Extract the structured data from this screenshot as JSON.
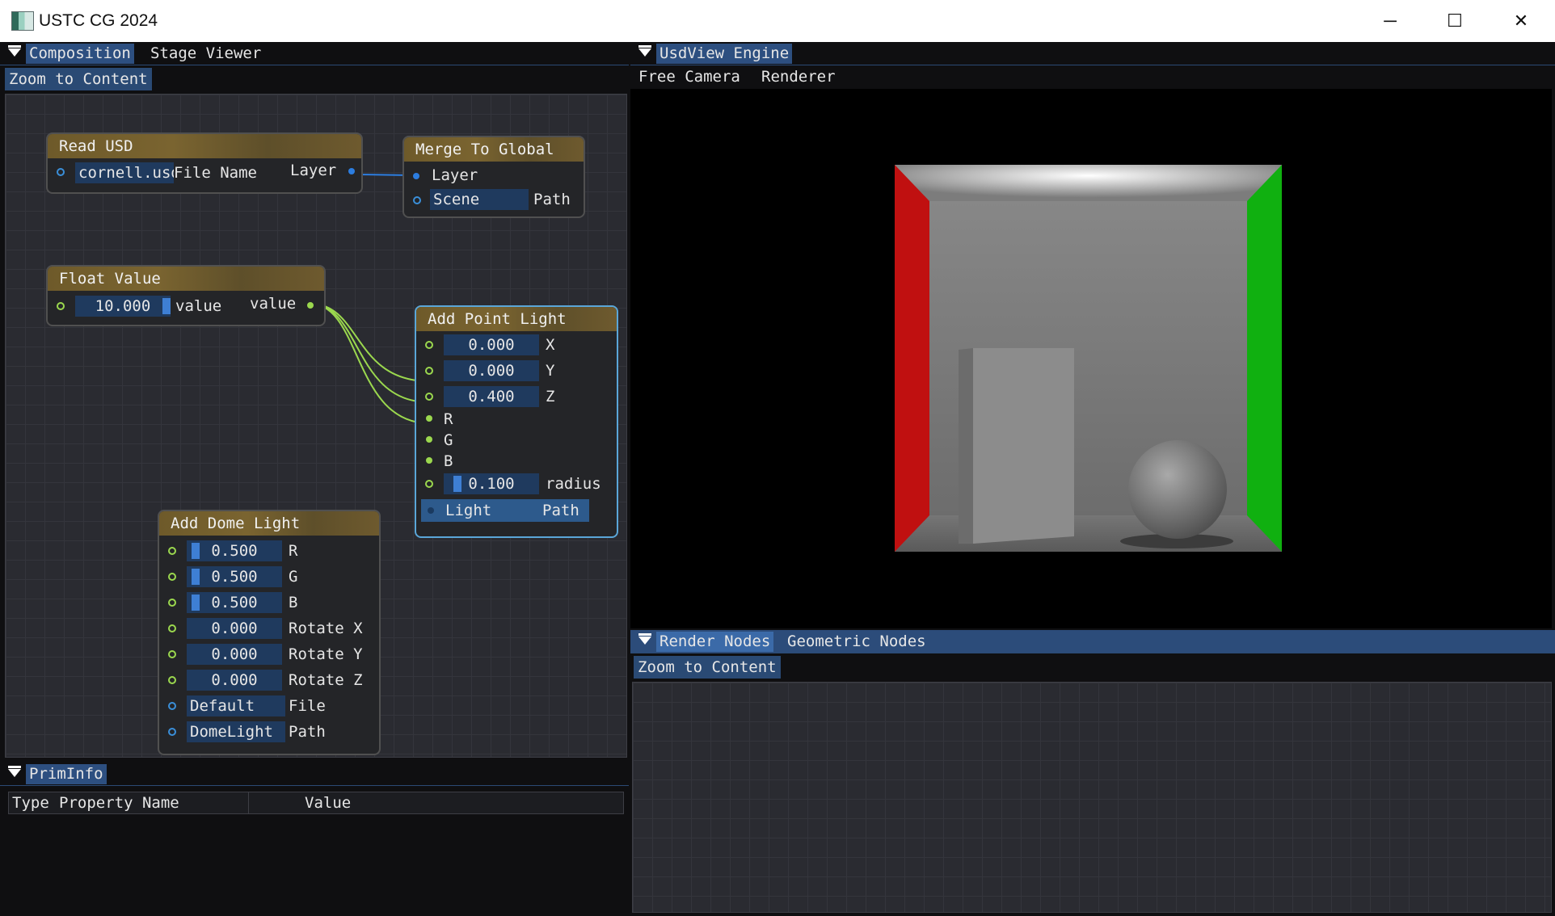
{
  "window": {
    "title": "USTC CG 2024",
    "controls": [
      "─",
      "☐",
      "✕"
    ]
  },
  "left_panel": {
    "tabs": [
      {
        "label": "Composition",
        "selected": true
      },
      {
        "label": "Stage Viewer",
        "selected": false
      }
    ],
    "zoom_button": "Zoom to Content",
    "nodes": {
      "read_usd": {
        "title": "Read USD",
        "file_value": "cornell.usda",
        "file_label": "File Name",
        "output_label": "Layer"
      },
      "merge_to_global": {
        "title": "Merge To Global",
        "input_layer": "Layer",
        "scene_value": "Scene",
        "path_label": "Path"
      },
      "float_value": {
        "title": "Float Value",
        "value": "10.000",
        "input_label": "value",
        "output_label": "value"
      },
      "add_point_light": {
        "title": "Add Point Light",
        "x": "0.000",
        "x_label": "X",
        "y": "0.000",
        "y_label": "Y",
        "z": "0.400",
        "z_label": "Z",
        "r_label": "R",
        "g_label": "G",
        "b_label": "B",
        "radius": "0.100",
        "radius_label": "radius",
        "light_value": "Light",
        "path_label": "Path"
      },
      "add_dome_light": {
        "title": "Add Dome Light",
        "r": "0.500",
        "r_label": "R",
        "g": "0.500",
        "g_label": "G",
        "b": "0.500",
        "b_label": "B",
        "rot_x": "0.000",
        "rot_x_label": "Rotate X",
        "rot_y": "0.000",
        "rot_y_label": "Rotate Y",
        "rot_z": "0.000",
        "rot_z_label": "Rotate Z",
        "file_value": "Default",
        "file_label": "File",
        "path_value": "DomeLight",
        "path_label": "Path"
      }
    }
  },
  "prim_info": {
    "tab": "PrimInfo",
    "columns": [
      "Type",
      "Property Name",
      "Value"
    ]
  },
  "usdview": {
    "tab": "UsdView Engine",
    "menu": [
      "Free Camera",
      "Renderer"
    ]
  },
  "render_nodes": {
    "tabs": [
      {
        "label": "Render Nodes",
        "selected": true
      },
      {
        "label": "Geometric Nodes",
        "selected": false
      }
    ],
    "zoom_button": "Zoom to Content"
  },
  "colors": {
    "accent": "#2c4c7a",
    "node_header": "#6e5a2a",
    "link_green": "#9bd84e",
    "link_blue": "#2c7de0",
    "wall_red": "#c01010",
    "wall_green": "#10b010"
  }
}
